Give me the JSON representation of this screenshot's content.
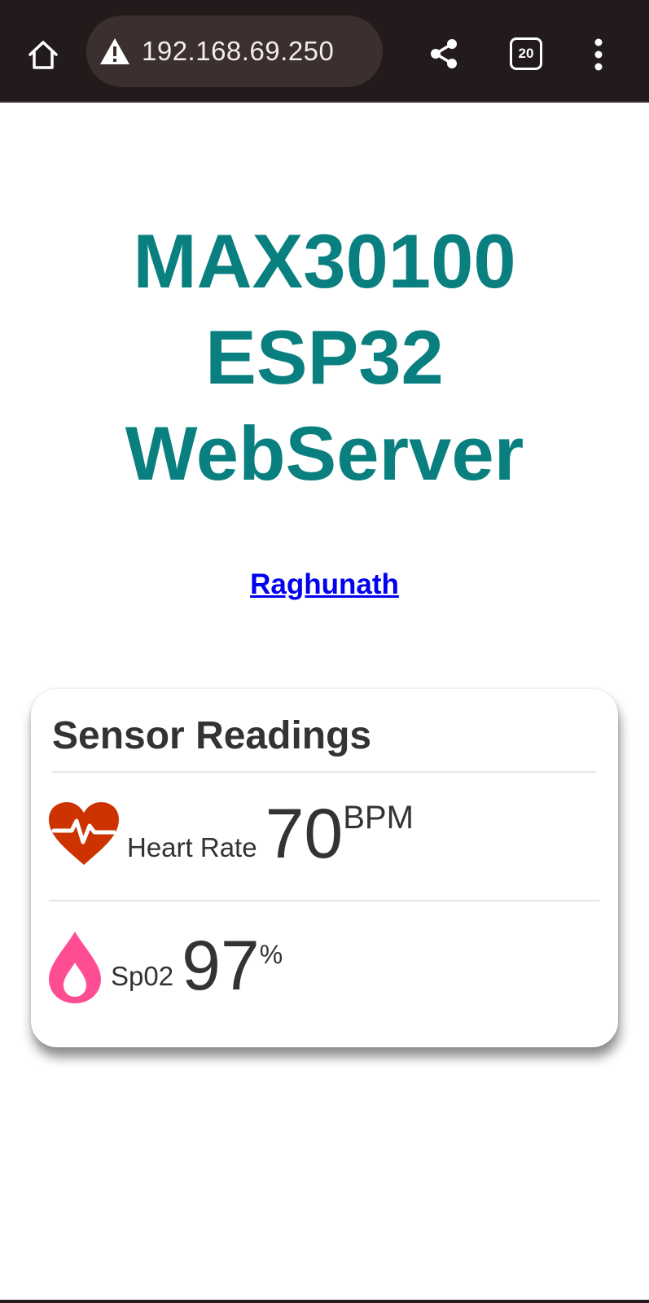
{
  "browser": {
    "url": "192.168.69.250",
    "tab_count": "20",
    "icons": {
      "home": "home-icon",
      "warning": "warning-icon",
      "share": "share-icon",
      "tabs": "tab-switcher-icon",
      "menu": "more-vert-icon"
    }
  },
  "page": {
    "title_line1": "MAX30100",
    "title_line2": "ESP32",
    "title_line3": "WebServer",
    "author_link": "Raghunath"
  },
  "card": {
    "title": "Sensor Readings",
    "heart_rate": {
      "icon": "heart-pulse-icon",
      "label": "Heart Rate",
      "value": "70",
      "unit": "BPM"
    },
    "spo2": {
      "icon": "drop-icon",
      "label": "Sp02",
      "value": "97",
      "unit": "%"
    }
  },
  "colors": {
    "toolbar": "#231b1b",
    "url_pill": "#3b2f2f",
    "title": "#0a7f7f",
    "link": "#0000ee",
    "heart": "#cc3300",
    "drop": "#ff4d94"
  }
}
